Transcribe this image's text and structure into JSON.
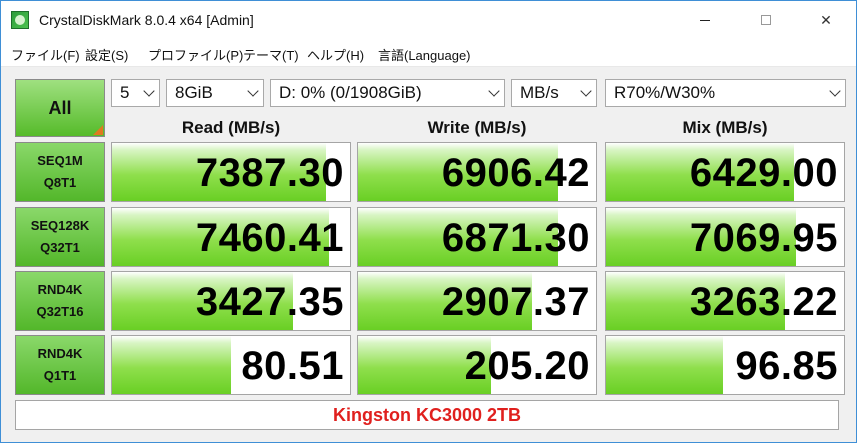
{
  "window": {
    "title": "CrystalDiskMark 8.0.4 x64 [Admin]"
  },
  "menu": [
    "ファイル(F)",
    "設定(S)",
    "プロファイル(P)",
    "テーマ(T)",
    "ヘルプ(H)",
    "言語(Language)"
  ],
  "controls": {
    "all_label": "All",
    "count": "5",
    "size": "8GiB",
    "drive": "D: 0% (0/1908GiB)",
    "unit": "MB/s",
    "mix": "R70%/W30%"
  },
  "headers": {
    "read": "Read (MB/s)",
    "write": "Write (MB/s)",
    "mix": "Mix (MB/s)"
  },
  "rows": [
    {
      "label1": "SEQ1M",
      "label2": "Q8T1",
      "read": "7387.30",
      "write": "6906.42",
      "mix": "6429.00",
      "read_pct": 0.9,
      "write_pct": 0.84,
      "mix_pct": 0.79
    },
    {
      "label1": "SEQ128K",
      "label2": "Q32T1",
      "read": "7460.41",
      "write": "6871.30",
      "mix": "7069.95",
      "read_pct": 0.91,
      "write_pct": 0.84,
      "mix_pct": 0.8
    },
    {
      "label1": "RND4K",
      "label2": "Q32T16",
      "read": "3427.35",
      "write": "2907.37",
      "mix": "3263.22",
      "read_pct": 0.76,
      "write_pct": 0.73,
      "mix_pct": 0.75
    },
    {
      "label1": "RND4K",
      "label2": "Q1T1",
      "read": "80.51",
      "write": "205.20",
      "mix": "96.85",
      "read_pct": 0.5,
      "write_pct": 0.56,
      "mix_pct": 0.49
    }
  ],
  "footer": {
    "text": "Kingston KC3000 2TB",
    "color": "#e0201e"
  },
  "colors": {
    "accent_green": "#69cf24",
    "label_green": "#53b72a"
  }
}
